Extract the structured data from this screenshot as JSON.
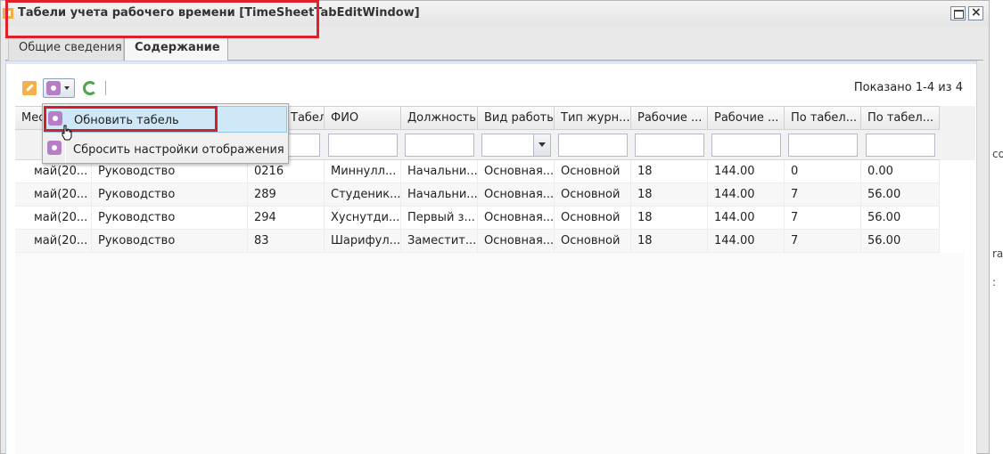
{
  "window": {
    "title": "Табели учета рабочего времени [TimeSheetTabEditWindow]"
  },
  "tabs": [
    {
      "label": "Общие сведения",
      "active": false
    },
    {
      "label": "Содержание",
      "active": true
    }
  ],
  "toolbar": {
    "paging_info": "Показано 1-4 из 4"
  },
  "menu": {
    "items": [
      {
        "label": "Обновить табель",
        "icon": "settings-gear-icon",
        "highlighted": true
      },
      {
        "label": "Сбросить настройки отображения",
        "icon": "settings-gear-icon",
        "highlighted": false
      }
    ]
  },
  "grid": {
    "columns": [
      "Мес",
      "",
      "Табельны...",
      "ФИО",
      "Должность",
      "Вид работы",
      "Тип журн...",
      "Рабочие ...",
      "Рабочие ...",
      "По табел...",
      "По табел..."
    ],
    "rows": [
      [
        "май(20...",
        "Руководство",
        "0216",
        "Миннулл...",
        "Начальни...",
        "Основная...",
        "Основной",
        "18",
        "144.00",
        "0",
        "0.00"
      ],
      [
        "май(20...",
        "Руководство",
        "289",
        "Студеник...",
        "Начальни...",
        "Основная...",
        "Основной",
        "18",
        "144.00",
        "7",
        "56.00"
      ],
      [
        "май(20...",
        "Руководство",
        "294",
        "Хуснутди...",
        "Первый з...",
        "Основная...",
        "Основной",
        "18",
        "144.00",
        "7",
        "56.00"
      ],
      [
        "май(20...",
        "Руководство",
        "83",
        "Шарифул...",
        "Заместит...",
        "Основная...",
        "Основной",
        "18",
        "144.00",
        "7",
        "56.00"
      ]
    ]
  },
  "background_window": {
    "fragments": [
      "co",
      "ra",
      ":"
    ]
  },
  "colors": {
    "highlight_box": "#e0202a",
    "tab_border": "#9aaecb",
    "menu_hover": "#cfe8f8"
  }
}
